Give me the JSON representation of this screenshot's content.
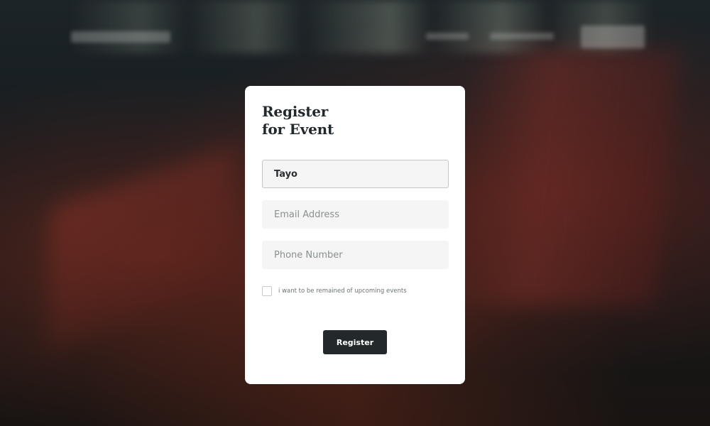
{
  "form": {
    "title_line1": "Register",
    "title_line2": "for Event",
    "name_value": "Tayo",
    "email_placeholder": "Email Address",
    "phone_placeholder": "Phone Number",
    "reminder_label": "i want to be remained of upcoming events",
    "reminder_checked": false,
    "submit_label": "Register"
  },
  "colors": {
    "card_background": "#ffffff",
    "title_text": "#22292c",
    "field_background": "#f5f5f5",
    "button_background": "#23292b",
    "button_text": "#ffffff"
  }
}
